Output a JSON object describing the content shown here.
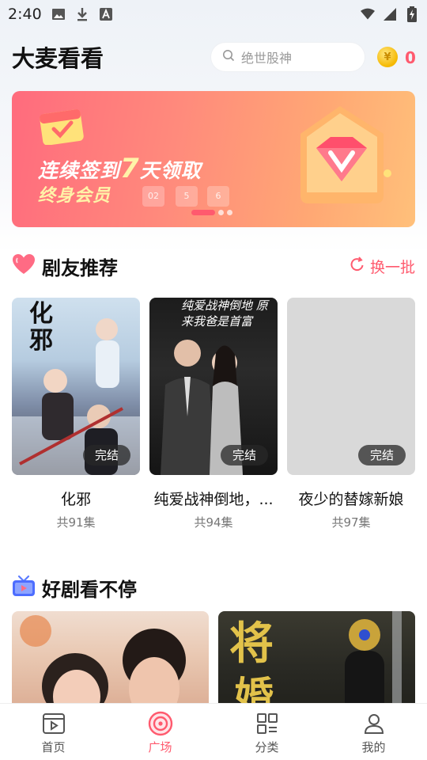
{
  "status_bar": {
    "time": "2:40"
  },
  "header": {
    "title": "大麦看看",
    "search_placeholder": "绝世股神",
    "coin_count": "0"
  },
  "banner": {
    "line1_a": "连续签到",
    "line1_num": "7",
    "line1_b": "天领取",
    "line2": "终身会员",
    "days": [
      "02",
      "5",
      "6"
    ],
    "active_index": 0,
    "colors": {
      "start": "#ff6b7d",
      "end": "#ffc07a"
    }
  },
  "section_recommend": {
    "title": "剧友推荐",
    "refresh_label": "换一批",
    "items": [
      {
        "title": "化邪",
        "count": "共91集",
        "badge": "完结",
        "poster_text": "化邪"
      },
      {
        "title": "纯爱战神倒地，...",
        "count": "共94集",
        "badge": "完结",
        "poster_text": "纯爱战神倒地 原来我爸是首富"
      },
      {
        "title": "夜少的替嫁新娘",
        "count": "共97集",
        "badge": "完结"
      }
    ]
  },
  "section_binge": {
    "title": "好剧看不停"
  },
  "bottom_nav": [
    {
      "label": "首页",
      "icon": "home-play-icon",
      "active": false
    },
    {
      "label": "广场",
      "icon": "plaza-disc-icon",
      "active": true
    },
    {
      "label": "分类",
      "icon": "category-grid-icon",
      "active": false
    },
    {
      "label": "我的",
      "icon": "profile-icon",
      "active": false
    }
  ],
  "colors": {
    "accent": "#ff5a6e",
    "coin": "#f5b800"
  }
}
